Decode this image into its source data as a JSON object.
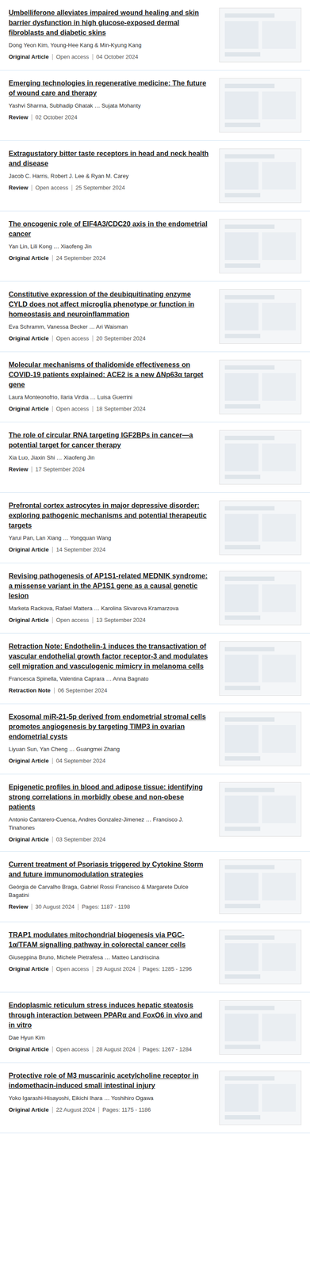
{
  "articles": [
    {
      "title": "Umbelliferone alleviates impaired wound healing and skin barrier dysfunction in high glucose-exposed dermal fibroblasts and diabetic skins",
      "authors": "Dong Yeon Kim, Young-Hee Kang & Min-Kyung Kang",
      "type": "Original Article",
      "open_access": true,
      "access_label": "Open access",
      "date": "04 October 2024",
      "pages": ""
    },
    {
      "title": "Emerging technologies in regenerative medicine: The future of wound care and therapy",
      "authors": "Yashvi Sharma, Subhadip Ghatak … Sujata Mohanty",
      "type": "Review",
      "open_access": false,
      "access_label": "",
      "date": "02 October 2024",
      "pages": ""
    },
    {
      "title": "Extragustatory bitter taste receptors in head and neck health and disease",
      "authors": "Jacob C. Harris, Robert J. Lee & Ryan M. Carey",
      "type": "Review",
      "open_access": true,
      "access_label": "Open access",
      "date": "25 September 2024",
      "pages": ""
    },
    {
      "title": "The oncogenic role of EIF4A3/CDC20 axis in the endometrial cancer",
      "authors": "Yan Lin, Lili Kong … Xiaofeng Jin",
      "type": "Original Article",
      "open_access": false,
      "access_label": "",
      "date": "24 September 2024",
      "pages": ""
    },
    {
      "title": "Constitutive expression of the deubiquitinating enzyme CYLD does not affect microglia phenotype or function in homeostasis and neuroinflammation",
      "authors": "Eva Schramm, Vanessa Becker … Ari Waisman",
      "type": "Original Article",
      "open_access": true,
      "access_label": "Open access",
      "date": "20 September 2024",
      "pages": ""
    },
    {
      "title": "Molecular mechanisms of thalidomide effectiveness on COVID-19 patients explained: ACE2 is a new ΔNp63α target gene",
      "authors": "Laura Monteonofrio, Ilaria Virdia … Luisa Guerrini",
      "type": "Original Article",
      "open_access": true,
      "access_label": "Open access",
      "date": "18 September 2024",
      "pages": ""
    },
    {
      "title": "The role of circular RNA targeting IGF2BPs in cancer—a potential target for cancer therapy",
      "authors": "Xia Luo, Jiaxin Shi … Xiaofeng Jin",
      "type": "Review",
      "open_access": false,
      "access_label": "",
      "date": "17 September 2024",
      "pages": ""
    },
    {
      "title": "Prefrontal cortex astrocytes in major depressive disorder: exploring pathogenic mechanisms and potential therapeutic targets",
      "authors": "Yarui Pan, Lan Xiang … Yongquan Wang",
      "type": "Original Article",
      "open_access": false,
      "access_label": "",
      "date": "14 September 2024",
      "pages": ""
    },
    {
      "title": "Revising pathogenesis of AP1S1-related MEDNIK syndrome: a missense variant in the AP1S1 gene as a causal genetic lesion",
      "authors": "Marketa Rackova, Rafael Mattera … Karolina Skvarova Kramarzova",
      "type": "Original Article",
      "open_access": true,
      "access_label": "Open access",
      "date": "13 September 2024",
      "pages": ""
    },
    {
      "title": "Retraction Note: Endothelin-1 induces the transactivation of vascular endothelial growth factor receptor-3 and modulates cell migration and vasculogenic mimicry in melanoma cells",
      "authors": "Francesca Spinella, Valentina Caprara … Anna Bagnato",
      "type": "Retraction Note",
      "open_access": false,
      "access_label": "",
      "date": "06 September 2024",
      "pages": ""
    },
    {
      "title": "Exosomal miR-21-5p derived from endometrial stromal cells promotes angiogenesis by targeting TIMP3 in ovarian endometrial cysts",
      "authors": "Liyuan Sun, Yan Cheng … Guangmei Zhang",
      "type": "Original Article",
      "open_access": false,
      "access_label": "",
      "date": "04 September 2024",
      "pages": ""
    },
    {
      "title": "Epigenetic profiles in blood and adipose tissue: identifying strong correlations in morbidly obese and non-obese patients",
      "authors": "Antonio Cantarero-Cuenca, Andres Gonzalez-Jimenez … Francisco J. Tinahones",
      "type": "Original Article",
      "open_access": false,
      "access_label": "",
      "date": "03 September 2024",
      "pages": ""
    },
    {
      "title": "Current treatment of Psoriasis triggered by Cytokine Storm and future immunomodulation strategies",
      "authors": "Geórgia de Carvalho Braga, Gabriel Rossi Francisco & Margarete Dulce Bagatini",
      "type": "Review",
      "open_access": false,
      "access_label": "",
      "date": "30 August 2024",
      "pages": "Pages: 1187 - 1198"
    },
    {
      "title": "TRAP1 modulates mitochondrial biogenesis via PGC-1α/TFAM signalling pathway in colorectal cancer cells",
      "authors": "Giuseppina Bruno, Michele Pietrafesa … Matteo Landriscina",
      "type": "Original Article",
      "open_access": true,
      "access_label": "Open access",
      "date": "29 August 2024",
      "pages": "Pages: 1285 - 1296"
    },
    {
      "title": "Endoplasmic reticulum stress induces hepatic steatosis through interaction between PPARα and FoxO6 in vivo and in vitro",
      "authors": "Dae Hyun Kim",
      "type": "Original Article",
      "open_access": true,
      "access_label": "Open access",
      "date": "28 August 2024",
      "pages": "Pages: 1267 - 1284"
    },
    {
      "title": "Protective role of M3 muscarinic acetylcholine receptor in indomethacin-induced small intestinal injury",
      "authors": "Yoko Igarashi-Hisayoshi, Eikichi Ihara … Yoshihiro Ogawa",
      "type": "Original Article",
      "open_access": false,
      "access_label": "",
      "date": "22 August 2024",
      "pages": "Pages: 1175 - 1186"
    }
  ]
}
